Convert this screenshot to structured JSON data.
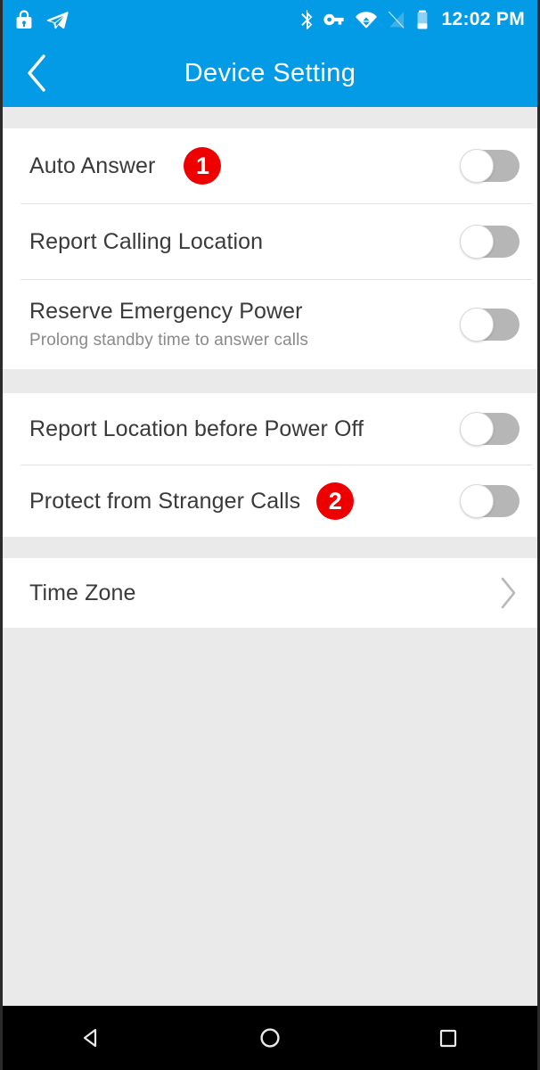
{
  "statusbar": {
    "time": "12:02 PM",
    "left_icons": [
      "lock-icon",
      "location-send-icon"
    ],
    "right_icons": [
      "bluetooth-icon",
      "vpn-key-icon",
      "wifi-icon",
      "signal-off-icon",
      "battery-icon"
    ]
  },
  "appbar": {
    "back_label": "back-chevron",
    "title": "Device Setting",
    "accent_color": "#039be5"
  },
  "sections": [
    {
      "rows": [
        {
          "title": "Auto Answer",
          "subtitle": "",
          "control": "toggle",
          "toggle_on": false,
          "badge": "1"
        },
        {
          "title": "Report Calling Location",
          "subtitle": "",
          "control": "toggle",
          "toggle_on": false,
          "badge": ""
        },
        {
          "title": "Reserve Emergency Power",
          "subtitle": "Prolong standby time to answer calls",
          "control": "toggle",
          "toggle_on": false,
          "badge": ""
        }
      ]
    },
    {
      "rows": [
        {
          "title": "Report Location before Power Off",
          "subtitle": "",
          "control": "toggle",
          "toggle_on": false,
          "badge": ""
        },
        {
          "title": "Protect from Stranger Calls",
          "subtitle": "",
          "control": "toggle",
          "toggle_on": false,
          "badge": "2"
        }
      ]
    },
    {
      "rows": [
        {
          "title": "Time Zone",
          "subtitle": "",
          "control": "chevron",
          "toggle_on": false,
          "badge": ""
        }
      ]
    }
  ],
  "navbar": {
    "back": "back-triangle",
    "home": "home-circle",
    "recents": "recents-square"
  },
  "colors": {
    "accent": "#039be5",
    "badge_red": "#ee0000",
    "background": "#eaeaea",
    "card": "#ffffff",
    "title_text": "#3a3a3a",
    "sub_text": "#8a8a8a",
    "toggle_track": "#b6b6b6"
  }
}
